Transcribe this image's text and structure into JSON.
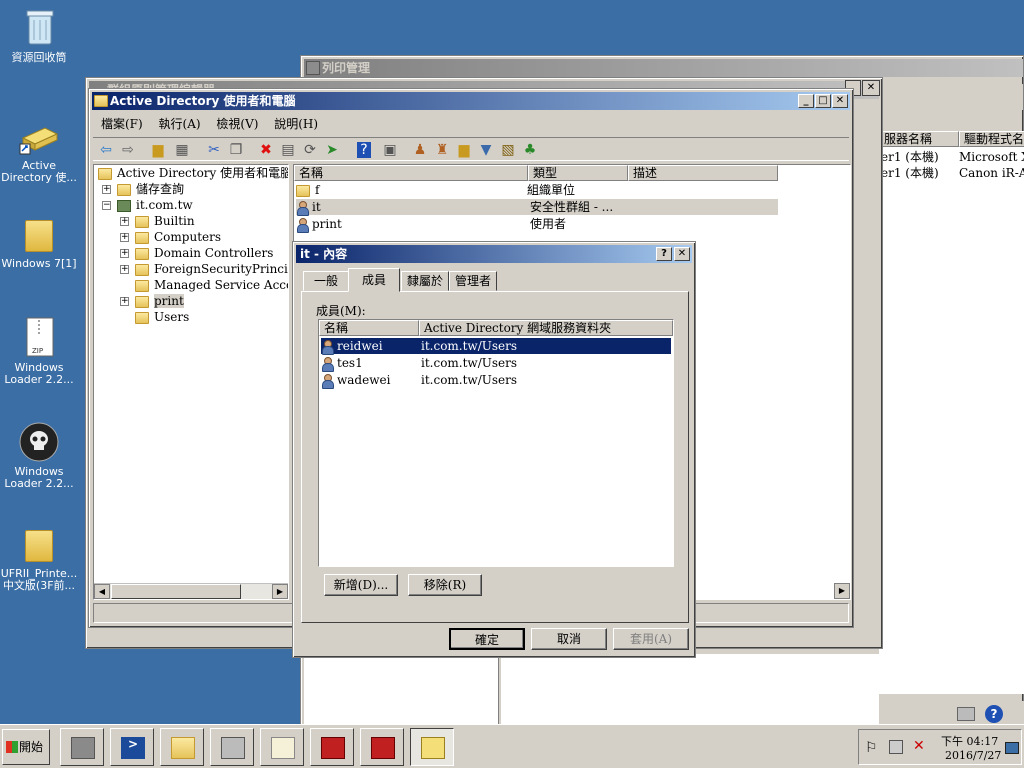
{
  "desktop": {
    "icons": [
      {
        "label": "資源回收筒"
      },
      {
        "label": "Active Directory 使..."
      },
      {
        "label": "Windows 7[1]"
      },
      {
        "label": "Windows Loader 2.2..."
      },
      {
        "label": "Windows Loader 2.2..."
      },
      {
        "label": "UFRII_Printe... 中文版(3F前..."
      }
    ]
  },
  "print_mgmt": {
    "title": "列印管理",
    "columns": [
      "服器名稱",
      "驅動程式名"
    ],
    "rows": [
      {
        "server": "er1 (本機)",
        "driver": "Microsoft XI"
      },
      {
        "server": "er1 (本機)",
        "driver": "Canon iR-AI"
      }
    ]
  },
  "back_window": {
    "title": "群組原則管理編輯器"
  },
  "ad_window": {
    "title": "Active Directory 使用者和電腦",
    "menu": [
      "檔案(F)",
      "執行(A)",
      "檢視(V)",
      "說明(H)"
    ],
    "tree": {
      "root": "Active Directory 使用者和電腦 [se",
      "saved_queries": "儲存查詢",
      "domain": "it.com.tw",
      "children": [
        "Builtin",
        "Computers",
        "Domain Controllers",
        "ForeignSecurityPrincipals",
        "Managed Service Accounts",
        "print",
        "Users"
      ]
    },
    "list": {
      "headers": [
        "名稱",
        "類型",
        "描述"
      ],
      "rows": [
        {
          "name": "f",
          "type": "組織單位"
        },
        {
          "name": "it",
          "type": "安全性群組 - ..."
        },
        {
          "name": "print",
          "type": "使用者"
        }
      ]
    }
  },
  "dialog": {
    "title": "it - 內容",
    "help": "?",
    "tabs": [
      "一般",
      "成員",
      "隸屬於",
      "管理者"
    ],
    "active_tab": "成員",
    "members_label": "成員(M):",
    "headers": [
      "名稱",
      "Active Directory 網域服務資料夾"
    ],
    "members": [
      {
        "name": "reidwei",
        "folder": "it.com.tw/Users",
        "selected": true
      },
      {
        "name": "tes1",
        "folder": "it.com.tw/Users",
        "selected": false
      },
      {
        "name": "wadewei",
        "folder": "it.com.tw/Users",
        "selected": false
      }
    ],
    "add": "新增(D)...",
    "remove": "移除(R)",
    "ok": "確定",
    "cancel": "取消",
    "apply": "套用(A)"
  },
  "taskbar": {
    "start": "開始",
    "time": "下午 04:17",
    "date": "2016/7/27"
  }
}
